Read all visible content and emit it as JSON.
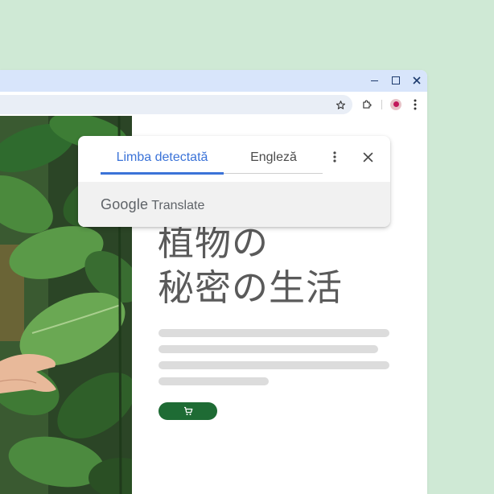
{
  "window": {
    "controls": {
      "minimize": "minimize-icon",
      "maximize": "maximize-icon",
      "close": "close-icon"
    }
  },
  "toolbar": {
    "icons": [
      "star-icon",
      "extensions-puzzle-icon",
      "profile-avatar",
      "more-vert-icon"
    ]
  },
  "translate_popup": {
    "tabs": [
      {
        "label": "Limba detectată",
        "active": true
      },
      {
        "label": "Engleză",
        "active": false
      }
    ],
    "brand_google": "Google",
    "brand_product": "Translate",
    "accent_color": "#3b73d8"
  },
  "page": {
    "headline_line1": "植物の",
    "headline_line2": "秘密の生活",
    "cart_button_icon": "shopping-cart-icon",
    "cart_button_color": "#1e6b34"
  },
  "colors": {
    "background": "#cfe9d5",
    "titlebar": "#d8e5fb"
  }
}
